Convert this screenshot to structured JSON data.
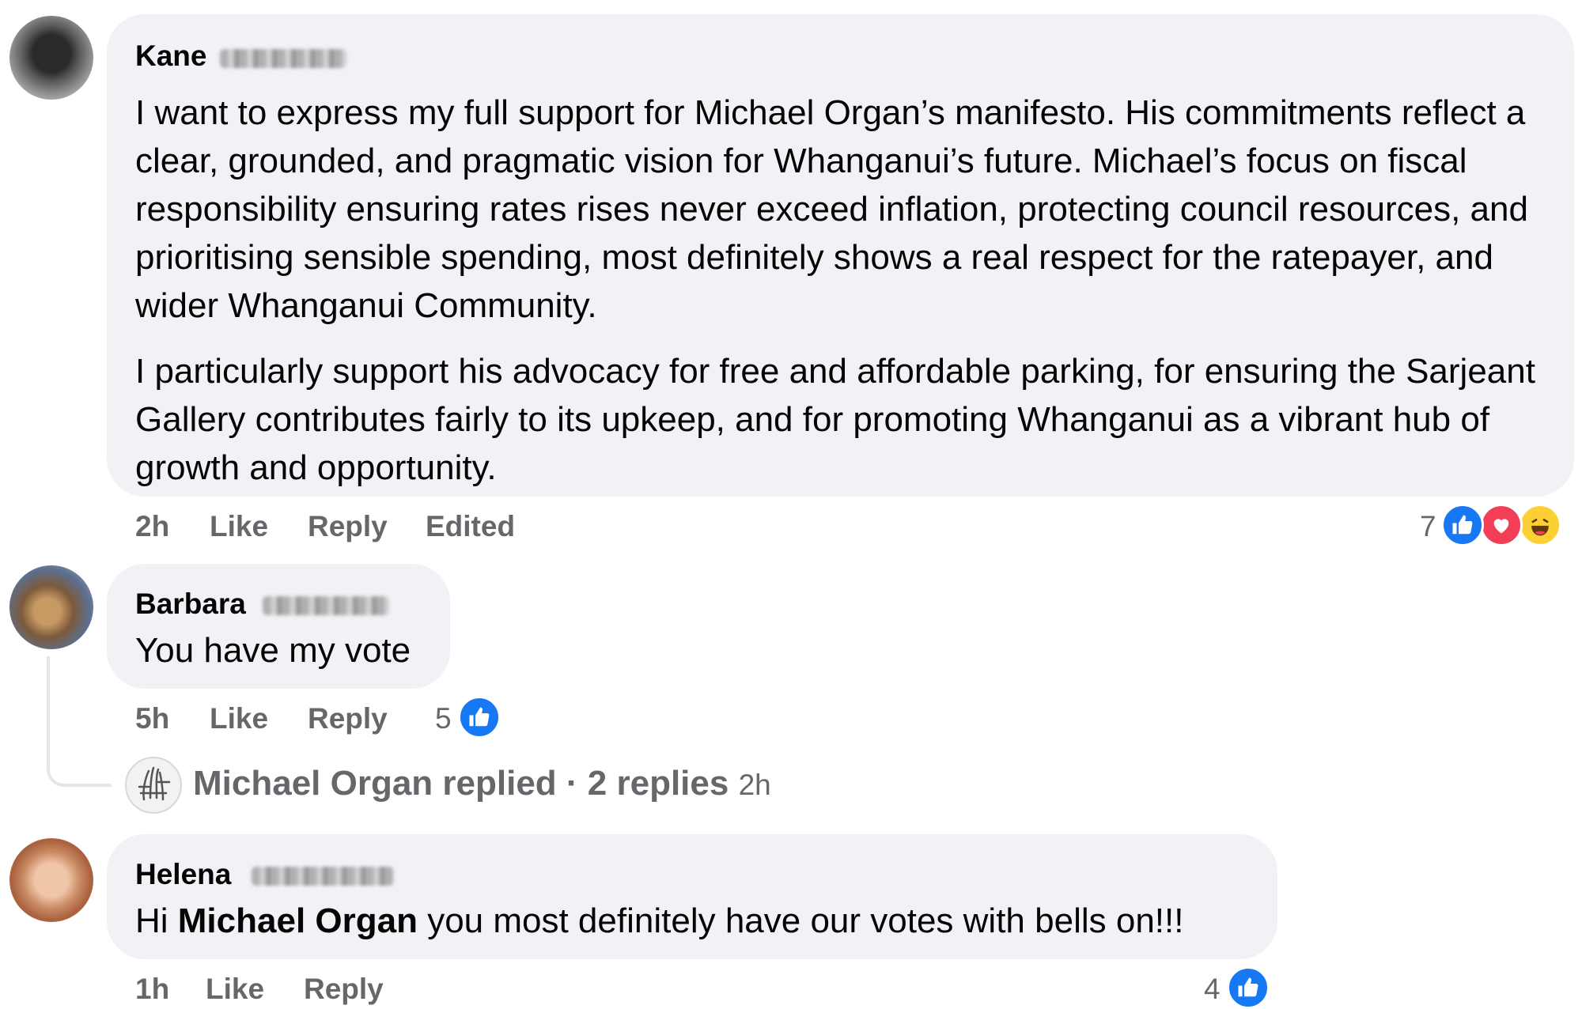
{
  "comments": [
    {
      "author_first": "Kane",
      "paragraphs": [
        "I want to express my full support for Michael Organ’s manifesto. His commitments reflect a clear, grounded, and pragmatic vision for Whanganui’s future. Michael’s focus on fiscal responsibility ensuring rates rises never exceed inflation, protecting council resources, and prioritising sensible spending, most definitely shows a real respect for the ratepayer, and wider Whanganui Community.",
        "I particularly support his advocacy for free and affordable parking, for ensuring the Sarjeant Gallery contributes fairly to its upkeep, and for promoting Whanganui as a vibrant hub of growth and opportunity."
      ],
      "time": "2h",
      "like_label": "Like",
      "reply_label": "Reply",
      "edited_label": "Edited",
      "reaction_count": "7",
      "reactions": [
        "like-icon",
        "love-icon",
        "haha-icon"
      ]
    },
    {
      "author_first": "Barbara",
      "text": "You have my vote",
      "time": "5h",
      "like_label": "Like",
      "reply_label": "Reply",
      "reaction_count": "5",
      "reactions": [
        "like-icon"
      ],
      "replies_summary": {
        "text": "Michael Organ replied · 2 replies",
        "time": "2h"
      }
    },
    {
      "author_first": "Helena",
      "text_pre": "Hi ",
      "mention": "Michael Organ",
      "text_post": " you most definitely have our votes with bells on!!!",
      "time": "1h",
      "like_label": "Like",
      "reply_label": "Reply",
      "reaction_count": "4",
      "reactions": [
        "like-icon"
      ]
    }
  ],
  "colors": {
    "bubble": "#f0f2f5",
    "meta_text": "#65676b",
    "like_blue": "#1877f2",
    "love_red": "#f33e58",
    "haha_yellow": "#fcd034"
  }
}
